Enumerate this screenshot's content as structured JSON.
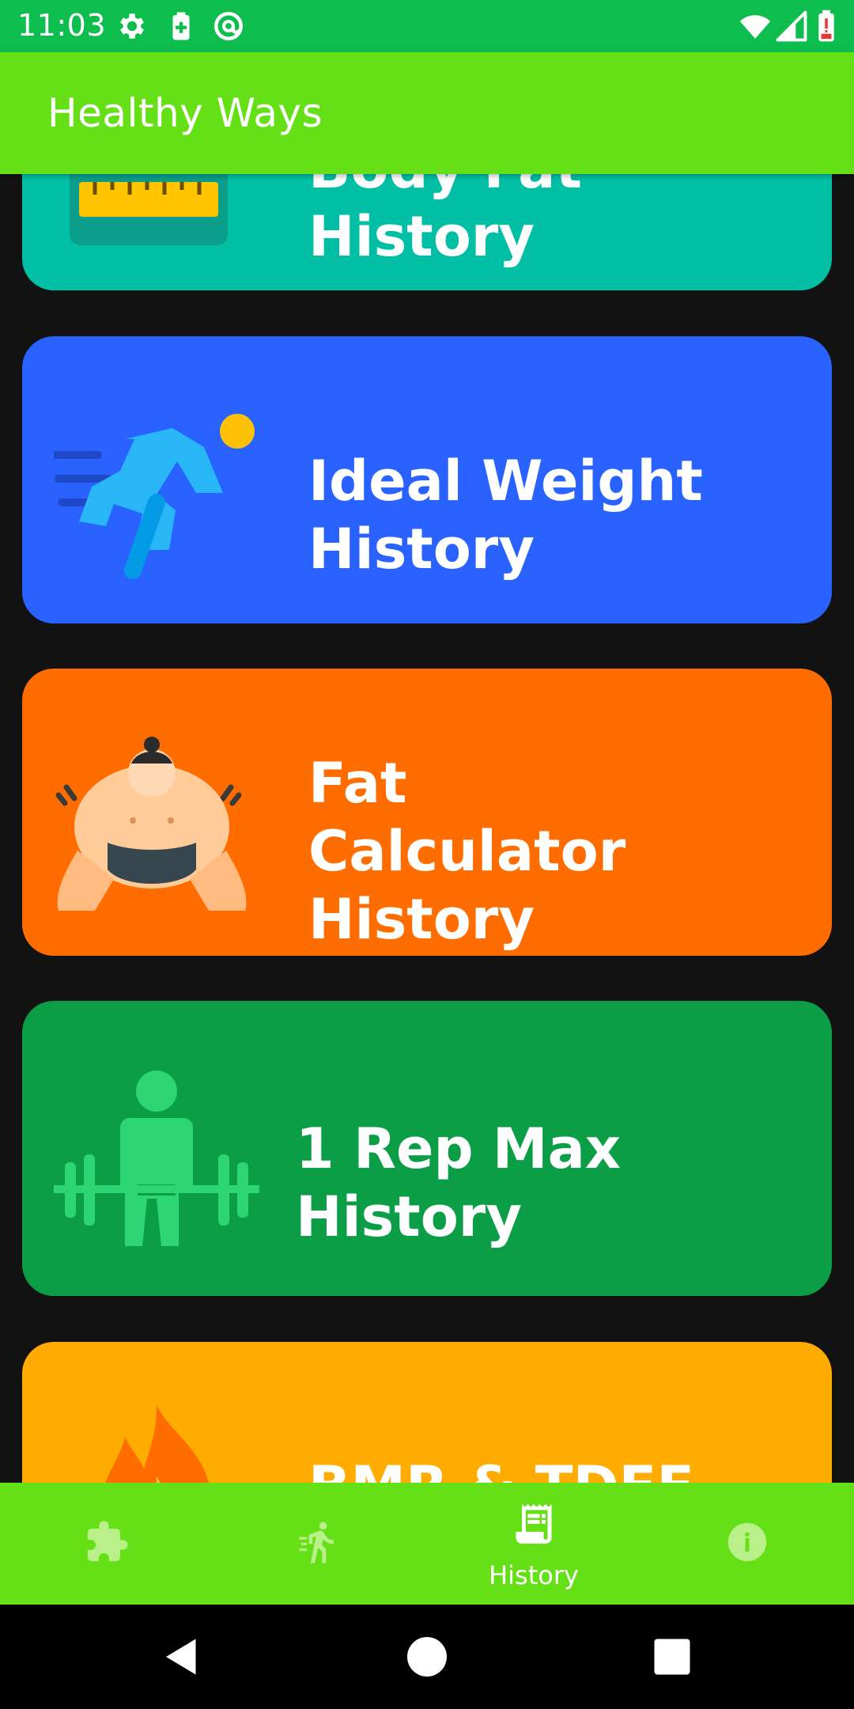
{
  "status_bar": {
    "time": "11:03",
    "icons": [
      "gear-icon",
      "battery-saver-icon",
      "at-sign-icon",
      "wifi-icon",
      "signal-icon",
      "battery-low-icon"
    ]
  },
  "app_bar": {
    "title": "Healthy Ways"
  },
  "cards": [
    {
      "label": "Body Fat History",
      "icon": "measuring-tape-icon",
      "color": "#00bfa5"
    },
    {
      "label": "Ideal Weight History",
      "icon": "runner-icon",
      "color": "#2962ff"
    },
    {
      "label": "Fat Calculator History",
      "icon": "sumo-wrestler-icon",
      "color": "#ff6d00"
    },
    {
      "label": "1 Rep Max History",
      "icon": "weightlifter-icon",
      "color": "#0b9e47"
    },
    {
      "label": "BMR & TDEE History",
      "icon": "fire-icon",
      "color": "#ffab00"
    }
  ],
  "bottom_nav": {
    "items": [
      {
        "icon": "puzzle-icon",
        "label": ""
      },
      {
        "icon": "running-person-icon",
        "label": ""
      },
      {
        "icon": "receipt-icon",
        "label": "History",
        "selected": true
      },
      {
        "icon": "info-icon",
        "label": ""
      }
    ]
  },
  "system_nav": {
    "buttons": [
      "back-icon",
      "home-icon",
      "recents-icon"
    ]
  },
  "colors": {
    "status_bar": "#0dbe4f",
    "app_bar": "#66e016",
    "background": "#121212"
  }
}
